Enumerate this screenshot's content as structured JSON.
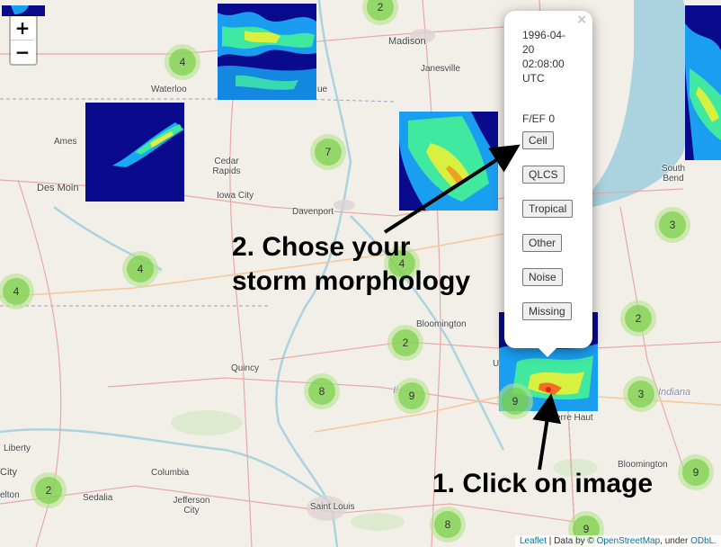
{
  "zoom": {
    "in_label": "+",
    "out_label": "−"
  },
  "labels": {
    "madison": "Madison",
    "janesville": "Janesville",
    "waterloo": "Waterloo",
    "ames": "Ames",
    "cedar_rapids": "Cedar Rapids",
    "des_moines": "Des Moin",
    "iowa_city": "Iowa City",
    "davenport": "Davenport",
    "south_bend": "South Bend",
    "bloomington_il": "Bloomington",
    "quincy": "Quincy",
    "indiana": "Indiana",
    "terre_haute": "Terre Haut",
    "bloomington_in": "Bloomington",
    "liberty": "Liberty",
    "columbia": "Columbia",
    "sedalia": "Sedalia",
    "jefferson_city": "Jefferson City",
    "saint_louis": "Saint Louis",
    "city_fragment": "City",
    "elton_fragment": "elton",
    "ue_fragment": "ue",
    "u_fragment": "U",
    "il_fragment": "Il"
  },
  "clusters": [
    "2",
    "4",
    "7",
    "4",
    "4",
    "4",
    "3",
    "2",
    "2",
    "8",
    "9",
    "9",
    "3",
    "9",
    "2",
    "8",
    "9"
  ],
  "popup": {
    "close": "×",
    "timestamp": "1996-04-20 02:08:00 UTC",
    "ef": "F/EF 0",
    "buttons": [
      "Cell",
      "QLCS",
      "Tropical",
      "Other",
      "Noise",
      "Missing"
    ]
  },
  "annotations": {
    "step2_line1": "2. Chose your",
    "step2_line2": "storm morphology",
    "step1": "1. Click on image"
  },
  "attribution": {
    "leaflet": "Leaflet",
    "sep": " | Data by © ",
    "osm": "OpenStreetMap",
    "under": ", under ",
    "odbl": "ODbL."
  }
}
